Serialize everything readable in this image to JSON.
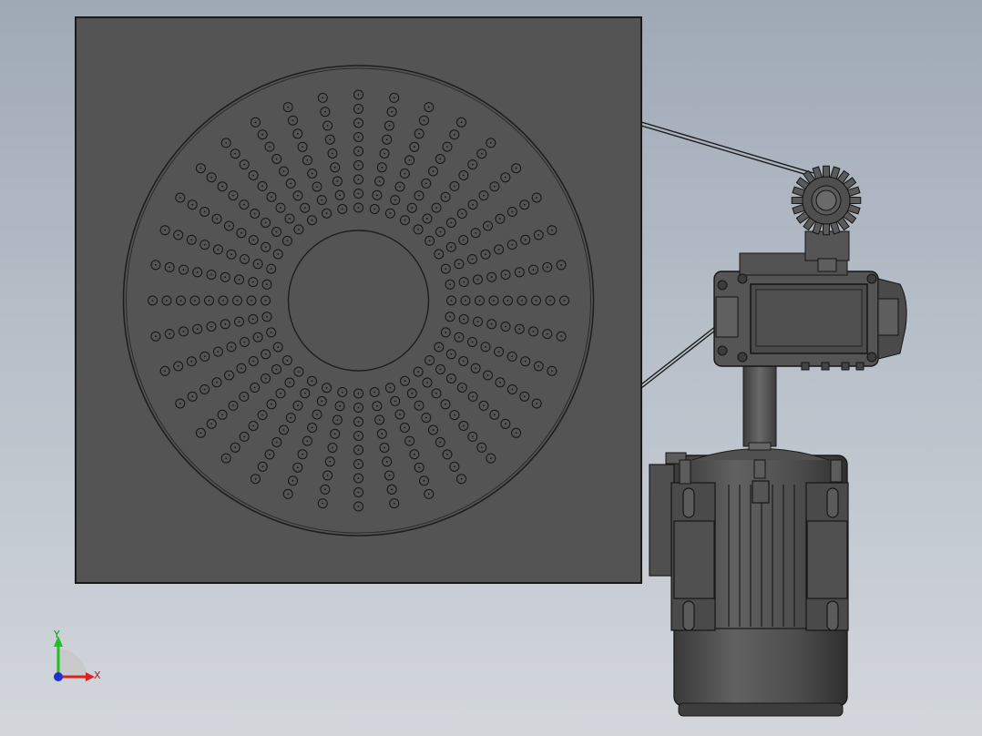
{
  "viewport": {
    "background_top": "#9fa9b6",
    "background_bottom": "#d3d7dc"
  },
  "model": {
    "body_color": "#545454",
    "edge_color": "#1a1a1a",
    "disk": {
      "ring_count": 36,
      "holes_per_ring": 9
    }
  },
  "triad": {
    "x_label": "X",
    "y_label": "Y",
    "x_color": "#e02020",
    "y_color": "#20c020",
    "z_color": "#2030d0"
  }
}
